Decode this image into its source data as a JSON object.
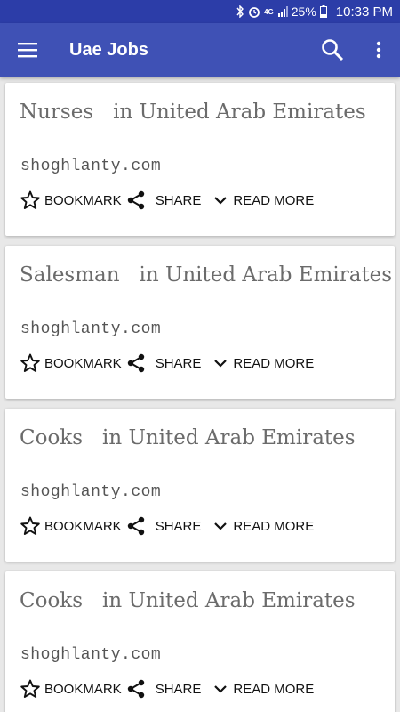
{
  "status_bar": {
    "bluetooth_icon": "bluetooth-icon",
    "alarm_icon": "alarm-icon",
    "network": "4G",
    "battery": "25%",
    "time": "10:33 PM"
  },
  "app_bar": {
    "title": "Uae Jobs",
    "menu_icon": "menu-icon",
    "search_icon": "search-icon",
    "more_icon": "more-vert-icon"
  },
  "colors": {
    "primary": "#3f51b5",
    "primary_dark": "#2c3da8",
    "card_title": "#6b6b6b"
  },
  "jobs": [
    {
      "title": "Nurses   in United Arab Emirates",
      "source": "shoghlanty.com",
      "bookmark": "BOOKMARK",
      "share": "SHARE",
      "read_more": "READ MORE"
    },
    {
      "title": "Salesman   in United Arab Emirates",
      "source": "shoghlanty.com",
      "bookmark": "BOOKMARK",
      "share": "SHARE",
      "read_more": "READ MORE"
    },
    {
      "title": "Cooks   in United Arab Emirates",
      "source": "shoghlanty.com",
      "bookmark": "BOOKMARK",
      "share": "SHARE",
      "read_more": "READ MORE"
    },
    {
      "title": "Cooks   in United Arab Emirates",
      "source": "shoghlanty.com",
      "bookmark": "BOOKMARK",
      "share": "SHARE",
      "read_more": "READ MORE"
    }
  ]
}
